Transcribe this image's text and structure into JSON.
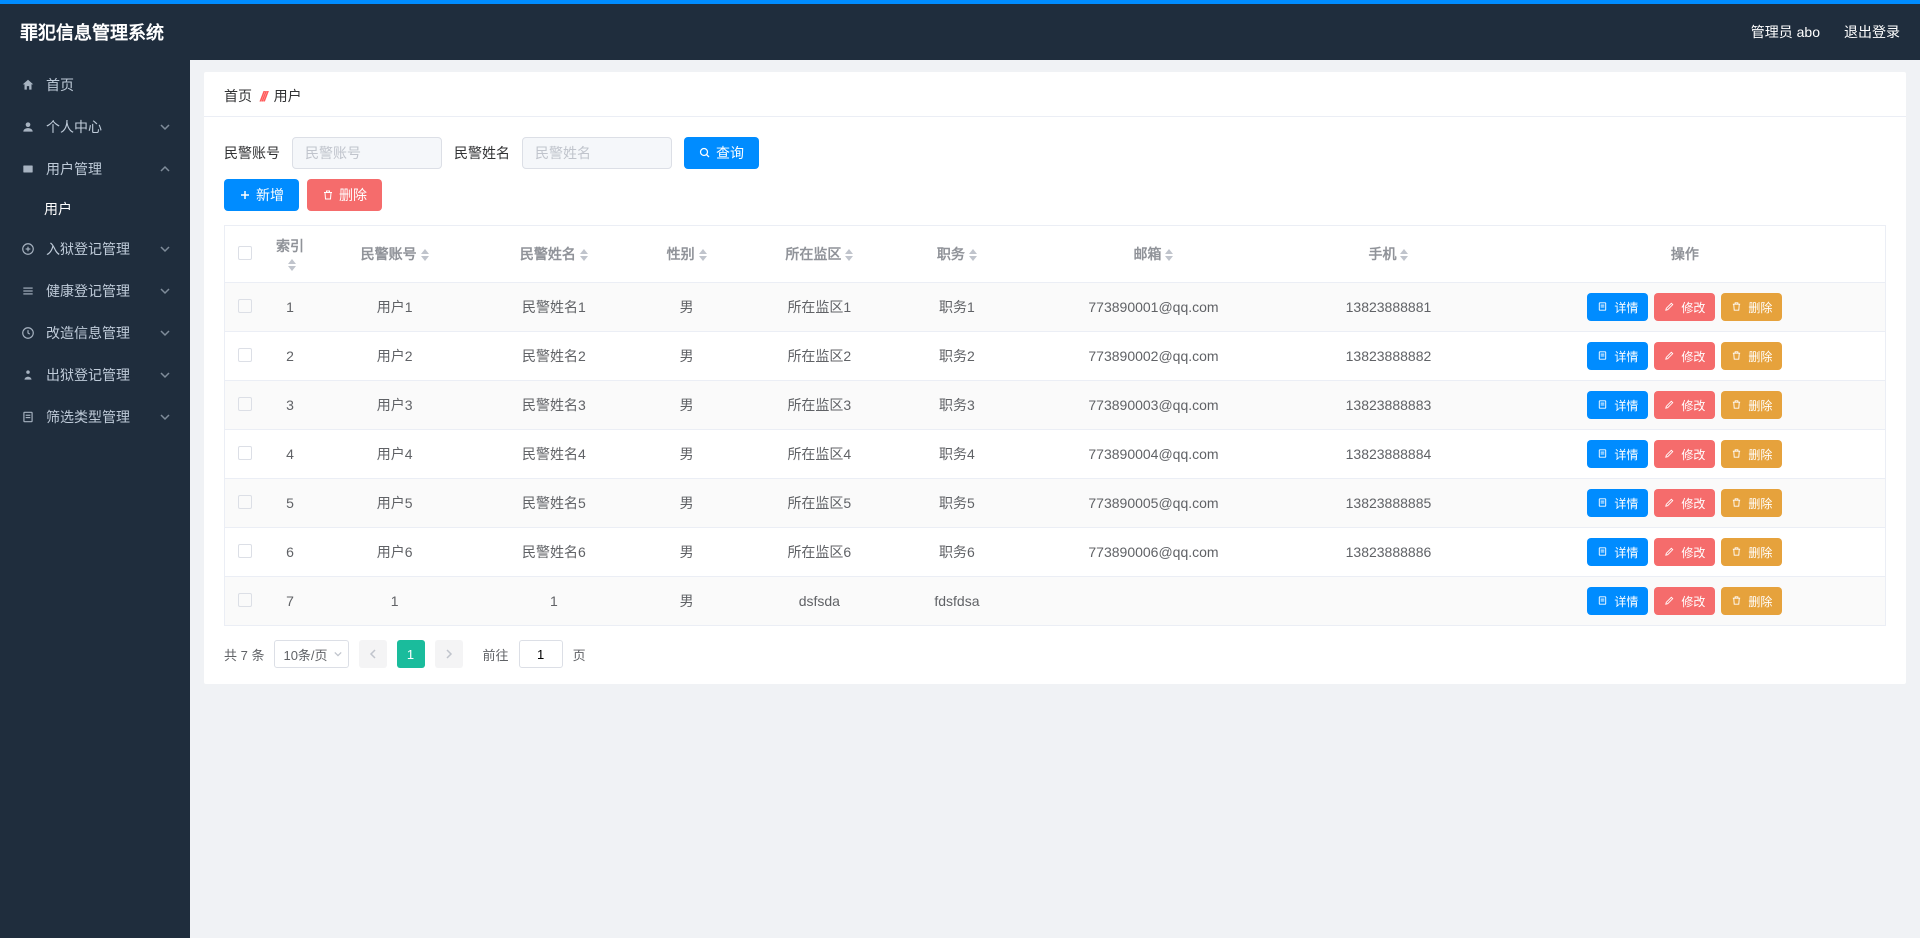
{
  "header": {
    "title": "罪犯信息管理系统",
    "admin_label": "管理员 abo",
    "logout_label": "退出登录"
  },
  "sidebar": {
    "items": [
      {
        "icon": "home",
        "label": "首页",
        "expandable": false
      },
      {
        "icon": "user",
        "label": "个人中心",
        "expandable": true
      },
      {
        "icon": "users",
        "label": "用户管理",
        "expandable": true,
        "expanded": true,
        "sub": "用户"
      },
      {
        "icon": "plus-circle",
        "label": "入狱登记管理",
        "expandable": true
      },
      {
        "icon": "list",
        "label": "健康登记管理",
        "expandable": true
      },
      {
        "icon": "clock",
        "label": "改造信息管理",
        "expandable": true
      },
      {
        "icon": "exit",
        "label": "出狱登记管理",
        "expandable": true
      },
      {
        "icon": "filter",
        "label": "筛选类型管理",
        "expandable": true
      }
    ]
  },
  "breadcrumb": {
    "home": "首页",
    "current": "用户"
  },
  "search": {
    "field1_label": "民警账号",
    "field1_placeholder": "民警账号",
    "field2_label": "民警姓名",
    "field2_placeholder": "民警姓名",
    "query_btn": "查询"
  },
  "actions": {
    "add": "新增",
    "delete": "删除"
  },
  "table": {
    "columns": [
      "索引",
      "民警账号",
      "民警姓名",
      "性别",
      "所在监区",
      "职务",
      "邮箱",
      "手机",
      "操作"
    ],
    "rows": [
      {
        "idx": "1",
        "account": "用户1",
        "name": "民警姓名1",
        "gender": "男",
        "zone": "所在监区1",
        "duty": "职务1",
        "email": "773890001@qq.com",
        "phone": "13823888881"
      },
      {
        "idx": "2",
        "account": "用户2",
        "name": "民警姓名2",
        "gender": "男",
        "zone": "所在监区2",
        "duty": "职务2",
        "email": "773890002@qq.com",
        "phone": "13823888882"
      },
      {
        "idx": "3",
        "account": "用户3",
        "name": "民警姓名3",
        "gender": "男",
        "zone": "所在监区3",
        "duty": "职务3",
        "email": "773890003@qq.com",
        "phone": "13823888883"
      },
      {
        "idx": "4",
        "account": "用户4",
        "name": "民警姓名4",
        "gender": "男",
        "zone": "所在监区4",
        "duty": "职务4",
        "email": "773890004@qq.com",
        "phone": "13823888884"
      },
      {
        "idx": "5",
        "account": "用户5",
        "name": "民警姓名5",
        "gender": "男",
        "zone": "所在监区5",
        "duty": "职务5",
        "email": "773890005@qq.com",
        "phone": "13823888885"
      },
      {
        "idx": "6",
        "account": "用户6",
        "name": "民警姓名6",
        "gender": "男",
        "zone": "所在监区6",
        "duty": "职务6",
        "email": "773890006@qq.com",
        "phone": "13823888886"
      },
      {
        "idx": "7",
        "account": "1",
        "name": "1",
        "gender": "男",
        "zone": "dsfsda",
        "duty": "fdsfdsa",
        "email": "",
        "phone": ""
      }
    ],
    "op_detail": "详情",
    "op_edit": "修改",
    "op_delete": "删除"
  },
  "pagination": {
    "total_text": "共 7 条",
    "page_size": "10条/页",
    "current": "1",
    "goto_prefix": "前往",
    "goto_value": "1",
    "goto_suffix": "页"
  }
}
